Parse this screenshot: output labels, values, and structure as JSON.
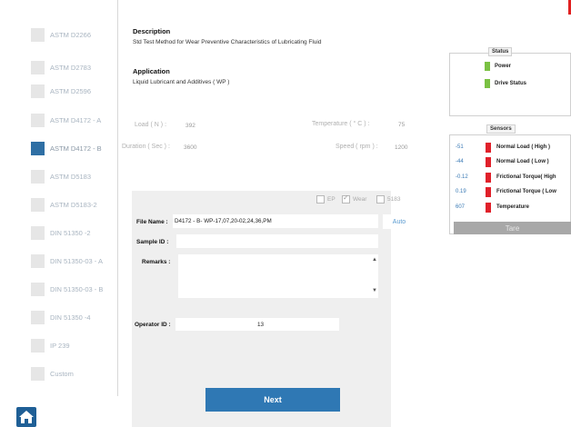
{
  "standards": [
    {
      "label": "ASTM D2266",
      "active": false
    },
    {
      "label": "ASTM D2783",
      "active": false
    },
    {
      "label": "ASTM D2596",
      "active": false
    },
    {
      "label": "ASTM D4172 - A",
      "active": false
    },
    {
      "label": "ASTM D4172 - B",
      "active": true
    },
    {
      "label": "ASTM D5183",
      "active": false
    },
    {
      "label": "ASTM D5183-2",
      "active": false
    },
    {
      "label": "DIN 51350 -2",
      "active": false
    },
    {
      "label": "DIN 51350-03 - A",
      "active": false
    },
    {
      "label": "DIN 51350-03 - B",
      "active": false
    },
    {
      "label": "DIN 51350 -4",
      "active": false
    },
    {
      "label": "IP 239",
      "active": false
    },
    {
      "label": "Custom",
      "active": false
    }
  ],
  "description": {
    "title": "Description",
    "text": "Std Test Method for Wear Preventive Characteristics of Lubricating  Fluid"
  },
  "application": {
    "title": "Application",
    "text": "Liquid Lubricant and Additives ( WP )"
  },
  "params": {
    "load_label": "Load ( N ) :",
    "load_value": "392",
    "temperature_label": "Temperature ( ° C ) :",
    "temperature_value": "75",
    "duration_label": "Duration ( Sec ) :",
    "duration_value": "3600",
    "speed_label": "Speed ( rpm ) :",
    "speed_value": "1200"
  },
  "checkboxes": [
    {
      "label": "EP",
      "checked": false
    },
    {
      "label": "Wear",
      "checked": true
    },
    {
      "label": "5183",
      "checked": false
    }
  ],
  "form": {
    "file_name_label": "File Name :",
    "file_name_value": "D4172 - B- WP-17,07,20-02,24,36,PM",
    "auto_label": "Auto",
    "sample_id_label": "Sample ID :",
    "sample_id_value": "",
    "remarks_label": "Remarks :",
    "remarks_value": "",
    "operator_id_label": "Operator ID :",
    "operator_id_value": "13"
  },
  "next_label": "Next",
  "status": {
    "title": "Status",
    "items": [
      {
        "label": "Power",
        "color": "#7ac143"
      },
      {
        "label": "Drive Status",
        "color": "#7ac143"
      }
    ]
  },
  "sensors": {
    "title": "Sensors",
    "items": [
      {
        "value": "-51",
        "label": "Normal Load ( High )"
      },
      {
        "value": "-44",
        "label": "Normal Load ( Low )"
      },
      {
        "value": "-0.12",
        "label": "Frictional Torque( High"
      },
      {
        "value": "0.19",
        "label": "Frictional Torque ( Low"
      },
      {
        "value": "607",
        "label": "Temperature"
      }
    ],
    "tare_label": "Tare"
  }
}
